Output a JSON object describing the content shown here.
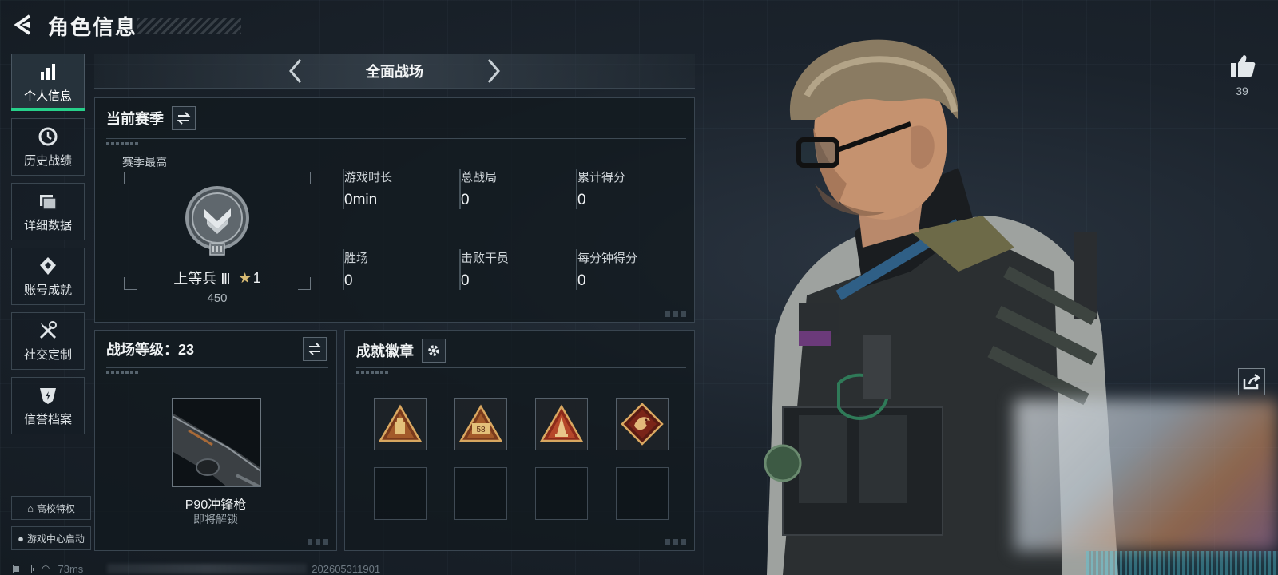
{
  "header": {
    "title": "角色信息"
  },
  "sidebar": {
    "items": [
      {
        "label": "个人信息",
        "icon": "bar-chart-icon",
        "active": true
      },
      {
        "label": "历史战绩",
        "icon": "history-icon",
        "active": false
      },
      {
        "label": "详细数据",
        "icon": "data-cards-icon",
        "active": false
      },
      {
        "label": "账号成就",
        "icon": "achievement-icon",
        "active": false
      },
      {
        "label": "社交定制",
        "icon": "tools-icon",
        "active": false
      },
      {
        "label": "信誉档案",
        "icon": "credit-shield-icon",
        "active": false
      }
    ],
    "campus_label": "高校特权",
    "gamecenter_label": "游戏中心启动"
  },
  "status_bar": {
    "ping": "73ms",
    "build_id": "202605311901",
    "battery_level": 0.3
  },
  "mode_selector": {
    "title": "全面战场"
  },
  "season_panel": {
    "title": "当前赛季",
    "best_label": "赛季最高",
    "rank_name": "上等兵 Ⅲ",
    "rank_stars": "1",
    "rank_points": "450",
    "stats": [
      {
        "label": "游戏时长",
        "value": "0min"
      },
      {
        "label": "总战局",
        "value": "0"
      },
      {
        "label": "累计得分",
        "value": "0"
      },
      {
        "label": "胜场",
        "value": "0"
      },
      {
        "label": "击败干员",
        "value": "0"
      },
      {
        "label": "每分钟得分",
        "value": "0"
      }
    ]
  },
  "battle_level_panel": {
    "title": "战场等级：23",
    "weapon_name": "P90冲锋枪",
    "weapon_status": "即将解锁"
  },
  "badge_panel": {
    "title": "成就徽章",
    "badges": [
      {
        "icon": "gold-triangle-badge-icon",
        "filled": true
      },
      {
        "icon": "gold-triangle-58-badge-icon",
        "filled": true,
        "text": "58"
      },
      {
        "icon": "red-triangle-badge-icon",
        "filled": true
      },
      {
        "icon": "dragon-diamond-badge-icon",
        "filled": true
      },
      {
        "filled": false
      },
      {
        "filled": false
      },
      {
        "filled": false
      },
      {
        "filled": false
      }
    ]
  },
  "likes": {
    "count": "39"
  },
  "colors": {
    "accent_green": "#27d08a",
    "panel_border": "#394550",
    "gold": "#d8bb73"
  }
}
